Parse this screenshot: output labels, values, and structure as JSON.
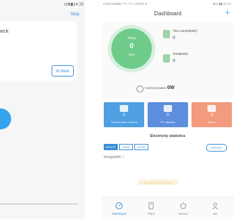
{
  "left": {
    "status_time": "⊙⊠▮14:15",
    "skip_label": "Skip",
    "check_text": "check",
    "mini_text": "ô",
    "next_label": "⊟ Next"
  },
  "phone": {
    "status": {
      "carrier": "China Mobile ⁴ᴳ ᵢₗ ⁴ᴳᵢₗ 4.67K/s ♥",
      "time": "⊕⊙ ▮▮ 14:17"
    },
    "header": {
      "title": "Dashboard",
      "add_icon": "plus-icon",
      "add_label": "+"
    },
    "today": {
      "label": "Today",
      "value": "0",
      "unit": "kWh"
    },
    "this_month": {
      "label": "This month(kWh)",
      "value": "0"
    },
    "total": {
      "label": "Total(kWh)",
      "value": "0"
    },
    "current_power": {
      "label": "Current power",
      "value": "0W"
    },
    "tiles": [
      {
        "value": "0",
        "label": "Total number of plant",
        "color": "#4f9fe2",
        "icon": "building-icon"
      },
      {
        "value": "0",
        "label": "PV capacity",
        "color": "#5d8ddd",
        "icon": "gauge-icon"
      },
      {
        "value": "0",
        "label": "Alarm",
        "color": "#f29b7e",
        "icon": "bell-icon"
      }
    ],
    "electricity": {
      "title": "Electricity statistics",
      "tabs": [
        "MONTH",
        "YEAR",
        "TOTAL"
      ],
      "export_label": "EXPORT",
      "energy_label": "Energy(kWh) ⓘ",
      "no_data": "No data, set more click"
    },
    "tabbar": [
      {
        "label": "Dashboard",
        "icon": "dashboard-icon"
      },
      {
        "label": "Plant",
        "icon": "plant-icon"
      },
      {
        "label": "Service",
        "icon": "service-icon"
      },
      {
        "label": "Me",
        "icon": "user-icon"
      }
    ]
  }
}
